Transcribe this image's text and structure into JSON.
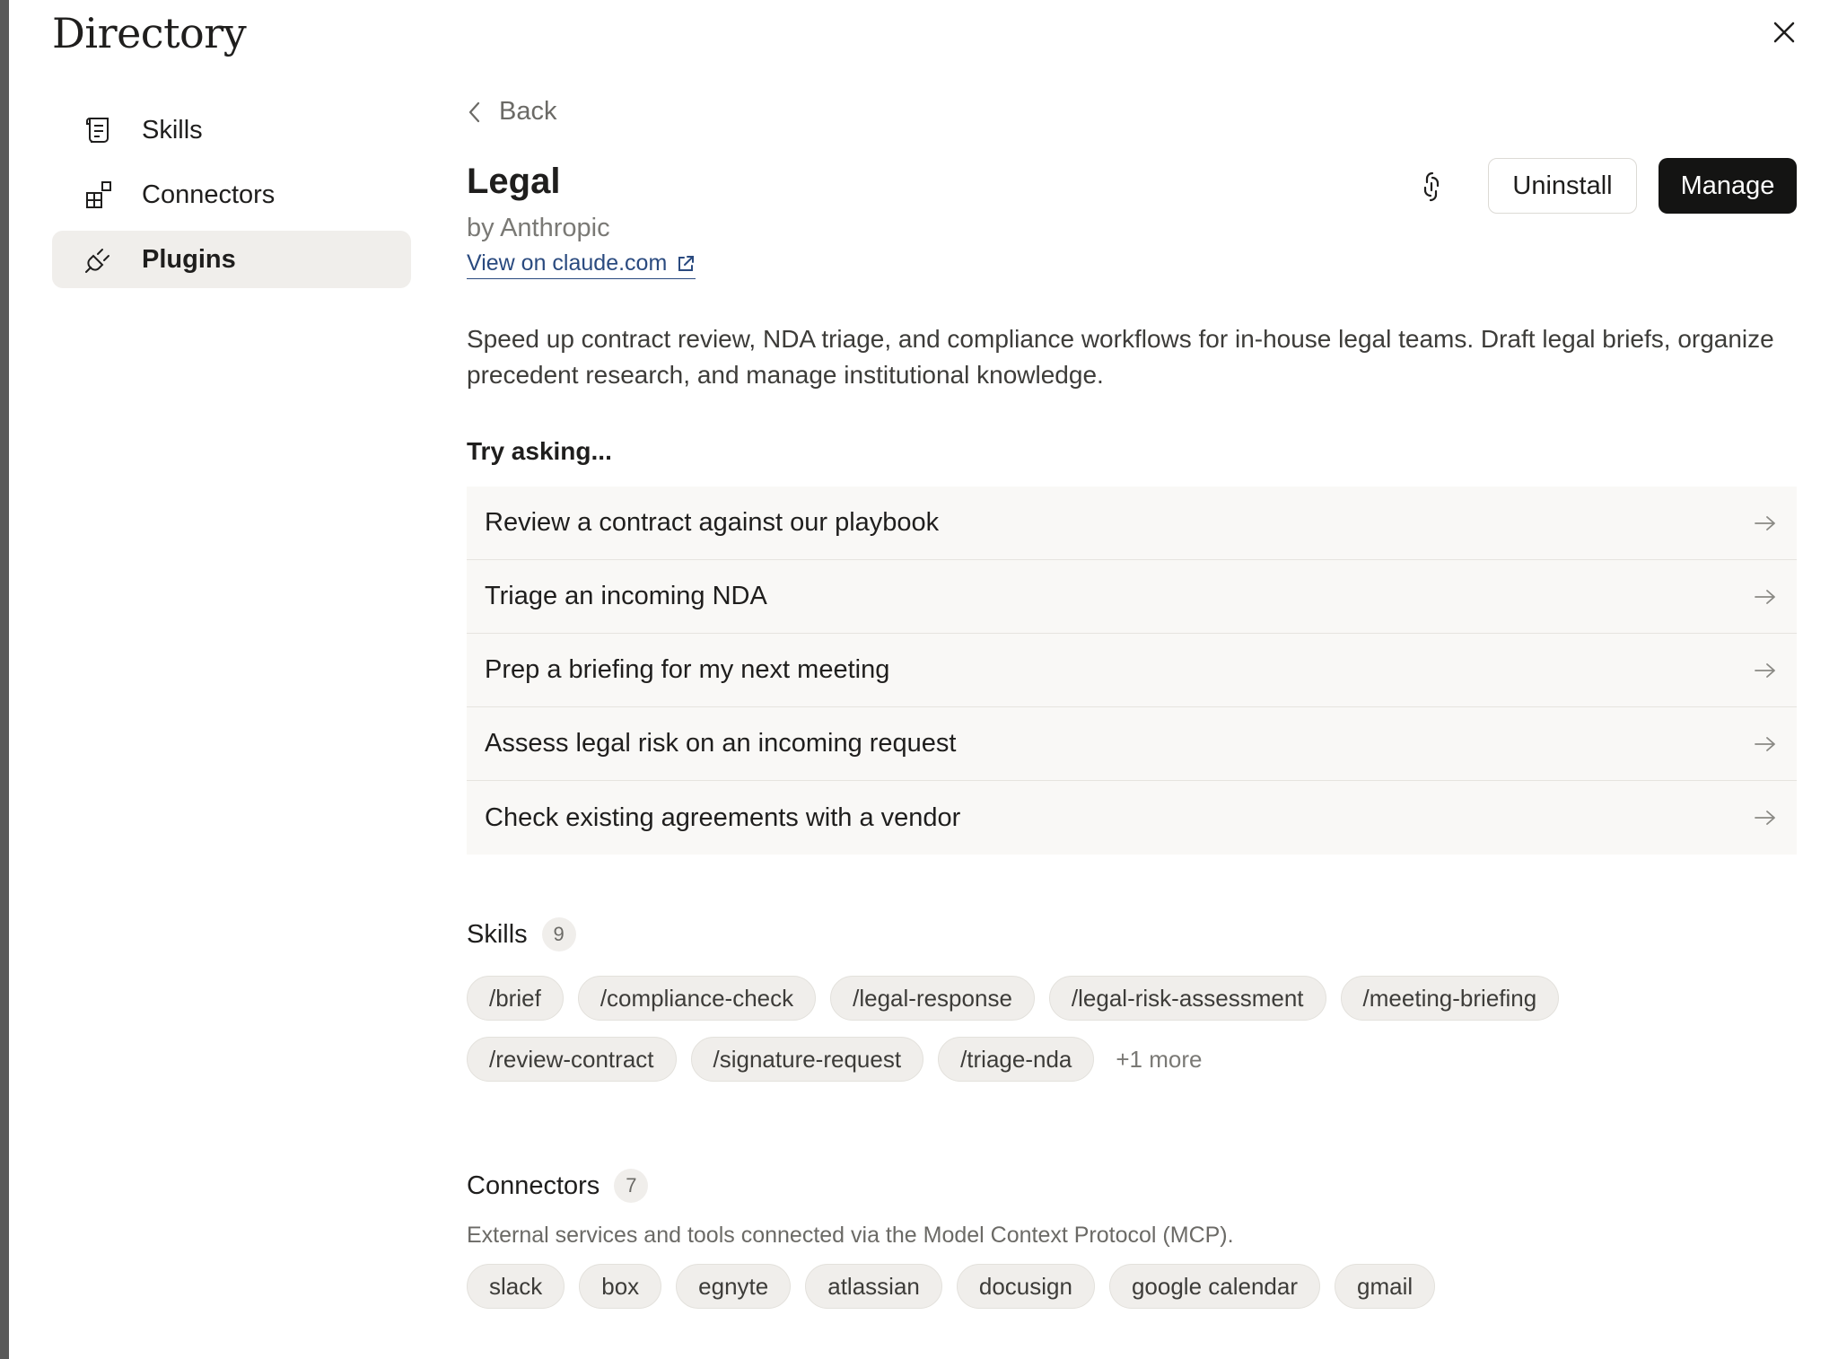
{
  "directory": {
    "title": "Directory"
  },
  "sidebar": {
    "items": [
      {
        "label": "Skills",
        "icon": "scroll-icon"
      },
      {
        "label": "Connectors",
        "icon": "connectors-icon"
      },
      {
        "label": "Plugins",
        "icon": "plug-icon",
        "active": true
      }
    ]
  },
  "plugin": {
    "back_label": "Back",
    "title": "Legal",
    "author": "by Anthropic",
    "view_link": "View on claude.com",
    "uninstall_label": "Uninstall",
    "manage_label": "Manage",
    "description": "Speed up contract review, NDA triage, and compliance workflows for in-house legal teams. Draft legal briefs, organize precedent research, and manage institutional knowledge."
  },
  "try_asking": {
    "heading": "Try asking...",
    "prompts": [
      "Review a contract against our playbook",
      "Triage an incoming NDA",
      "Prep a briefing for my next meeting",
      "Assess legal risk on an incoming request",
      "Check existing agreements with a vendor"
    ]
  },
  "skills": {
    "label": "Skills",
    "count": "9",
    "chips": [
      "/brief",
      "/compliance-check",
      "/legal-response",
      "/legal-risk-assessment",
      "/meeting-briefing",
      "/review-contract",
      "/signature-request",
      "/triage-nda"
    ],
    "more": "+1 more"
  },
  "connectors": {
    "label": "Connectors",
    "count": "7",
    "description": "External services and tools connected via the Model Context Protocol (MCP).",
    "chips": [
      "slack",
      "box",
      "egnyte",
      "atlassian",
      "docusign",
      "google calendar",
      "gmail"
    ]
  },
  "colors": {
    "primary_button": "#141413",
    "active_nav_bg": "#f0eeeb",
    "link": "#2a4a7f"
  }
}
